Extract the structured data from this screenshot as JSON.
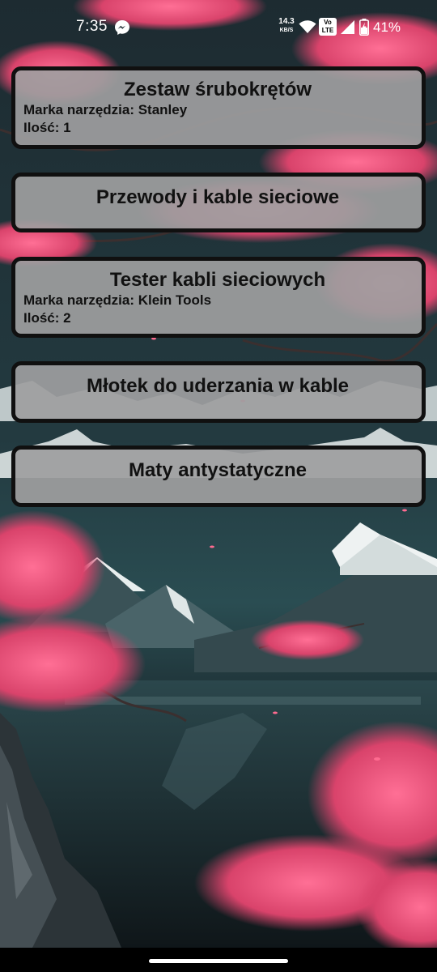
{
  "status_bar": {
    "time": "7:35",
    "net_speed_value": "14.3",
    "net_speed_unit": "KB/S",
    "volte_top": "Vo",
    "volte_bottom": "LTE",
    "battery_percent": "41%",
    "icons": [
      "messenger-icon",
      "wifi-icon",
      "volte-icon",
      "signal-icon",
      "battery-charging-icon"
    ]
  },
  "background": {
    "description_icon": "cherry-blossom-mountain-lake-wallpaper",
    "colors": {
      "sky_dark": "#1a2a2e",
      "blossom": "#e8547c",
      "snow": "#e6ecec",
      "mountain": "#2c3f44"
    }
  },
  "tools": [
    {
      "name": "Zestaw śrubokrętów",
      "brand_line": "Marka narzędzia: Stanley",
      "qty_line": "Ilość: 1"
    },
    {
      "name": "Przewody i kable sieciowe"
    },
    {
      "name": "Tester kabli sieciowych",
      "brand_line": "Marka narzędzia: Klein Tools",
      "qty_line": "Ilość: 2"
    },
    {
      "name": "Młotek do uderzania w kable"
    },
    {
      "name": "Maty antystatyczne"
    }
  ],
  "card_style": {
    "background": "#9e9ea0",
    "border": "#101010"
  }
}
